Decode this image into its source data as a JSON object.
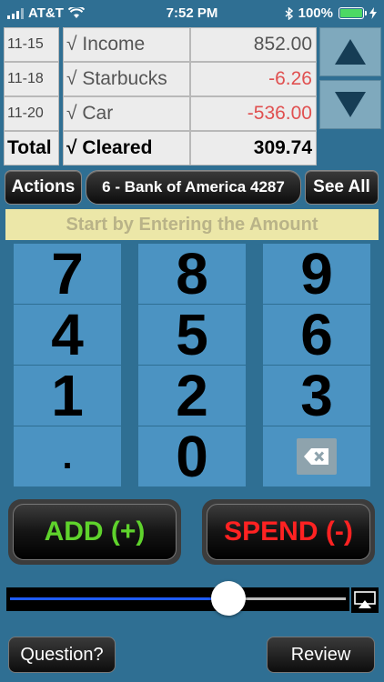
{
  "status_bar": {
    "carrier": "AT&T",
    "time": "7:52 PM",
    "battery": "100%"
  },
  "transactions": [
    {
      "date": "11-15",
      "description": "√ Income",
      "amount": "852.00",
      "negative": false
    },
    {
      "date": "11-18",
      "description": "√ Starbucks",
      "amount": "-6.26",
      "negative": true
    },
    {
      "date": "11-20",
      "description": "√ Car",
      "amount": "-536.00",
      "negative": true
    }
  ],
  "totals": {
    "label": "Total",
    "description": "√ Cleared",
    "amount": "309.74"
  },
  "actions": {
    "actions_label": "Actions",
    "account_label": "6 - Bank of America 4287",
    "see_all_label": "See All"
  },
  "prompt": "Start by Entering the Amount",
  "keypad": {
    "keys": [
      "7",
      "8",
      "9",
      "4",
      "5",
      "6",
      "1",
      "2",
      "3",
      ".",
      "0"
    ]
  },
  "buttons": {
    "add": "ADD (+)",
    "spend": "SPEND (-)",
    "question": "Question?",
    "review": "Review"
  },
  "slider": {
    "value": 0.65
  },
  "colors": {
    "background": "#2f6f93",
    "key": "#4b93c2",
    "add": "#5fd32c",
    "spend": "#ff2222",
    "negative_amount": "#e05050",
    "prompt_bg": "#ece7a8"
  }
}
